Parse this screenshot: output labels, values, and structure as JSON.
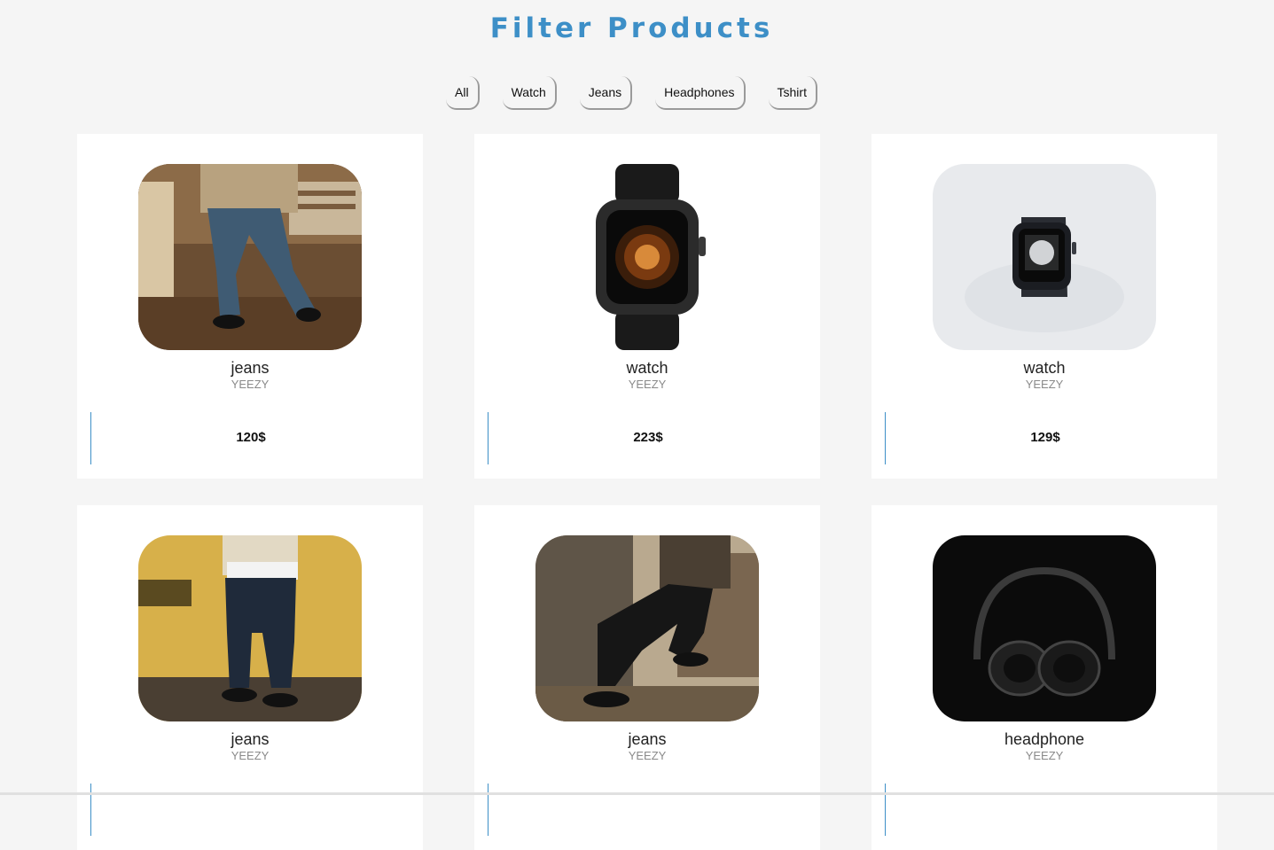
{
  "page": {
    "title": "Filter Products"
  },
  "filters": [
    "All",
    "Watch",
    "Jeans",
    "Headphones",
    "Tshirt"
  ],
  "products": [
    {
      "name": "jeans",
      "brand": "YEEZY",
      "price": "120$",
      "image": "jeans-store-photo"
    },
    {
      "name": "watch",
      "brand": "YEEZY",
      "price": "223$",
      "image": "black-smartwatch-photo"
    },
    {
      "name": "watch",
      "brand": "YEEZY",
      "price": "129$",
      "image": "smartwatch-on-white-photo"
    },
    {
      "name": "jeans",
      "brand": "YEEZY",
      "price": "",
      "image": "jeans-yellow-wall-photo"
    },
    {
      "name": "jeans",
      "brand": "YEEZY",
      "price": "",
      "image": "jeans-gate-photo"
    },
    {
      "name": "headphone",
      "brand": "YEEZY",
      "price": "",
      "image": "black-headphones-photo"
    }
  ],
  "colors": {
    "accent": "#3d8fc7",
    "background": "#f5f5f5",
    "card": "#ffffff"
  }
}
